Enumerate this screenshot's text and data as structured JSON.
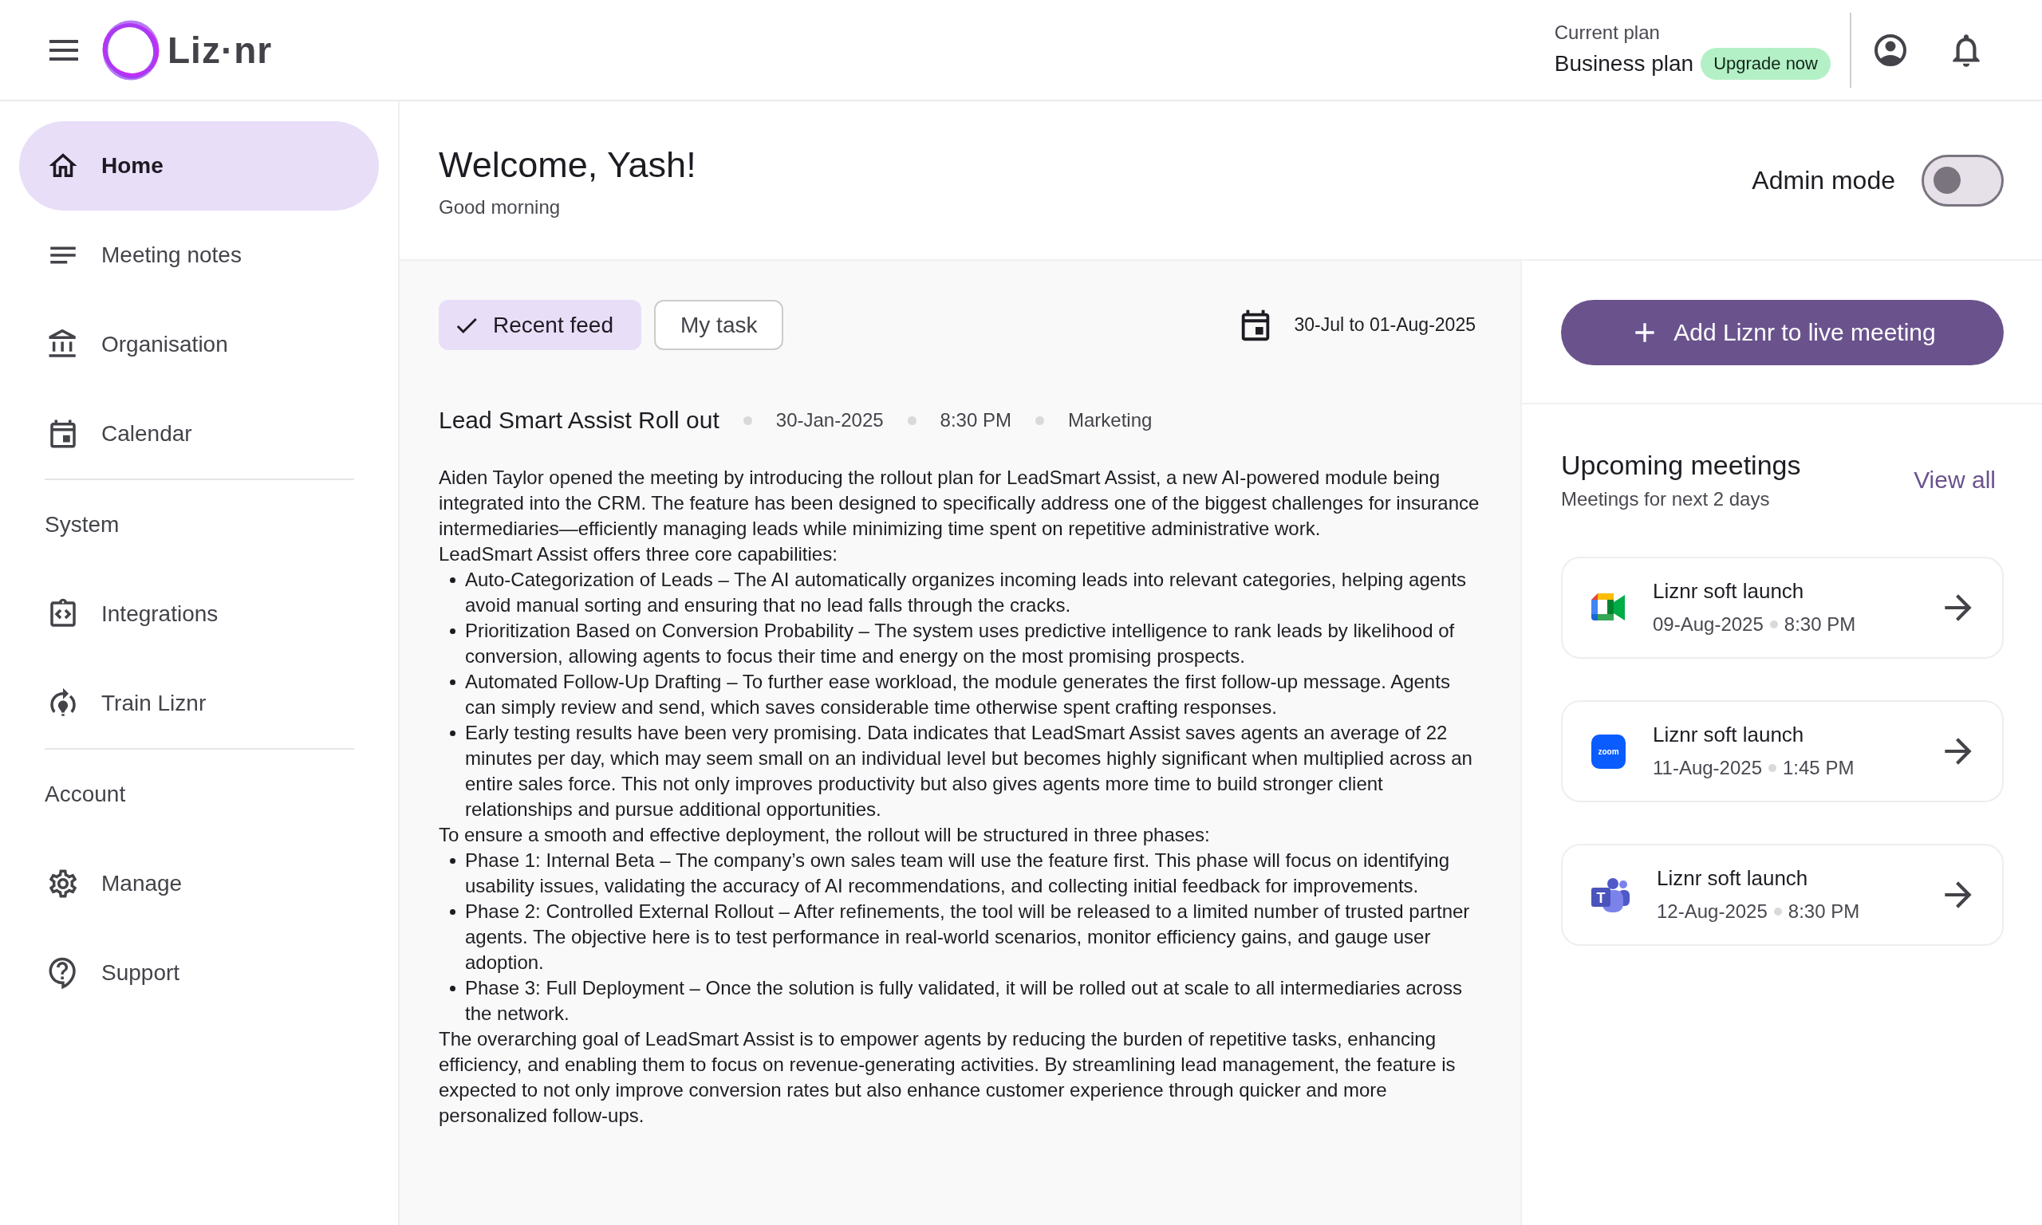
{
  "header": {
    "logo_text": "Liz·nr",
    "plan": {
      "caption": "Current plan",
      "name": "Business plan",
      "badge": "Upgrade now"
    }
  },
  "sidebar": {
    "sections": [
      {
        "items": [
          {
            "label": "Home",
            "selected": true
          },
          {
            "label": "Meeting notes",
            "selected": false
          },
          {
            "label": "Organisation",
            "selected": false
          },
          {
            "label": "Calendar",
            "selected": false
          }
        ]
      },
      {
        "heading": "System",
        "items": [
          {
            "label": "Integrations",
            "selected": false
          },
          {
            "label": "Train Liznr",
            "selected": false
          }
        ]
      },
      {
        "heading": "Account",
        "items": [
          {
            "label": "Manage",
            "selected": false
          },
          {
            "label": "Support",
            "selected": false
          }
        ]
      }
    ]
  },
  "welcome": {
    "title": "Welcome, Yash!",
    "subtitle": "Good morning"
  },
  "admin_mode": {
    "label": "Admin mode",
    "on": false
  },
  "tabs": [
    {
      "label": "Recent feed",
      "selected": true
    },
    {
      "label": "My task",
      "selected": false
    }
  ],
  "date_range": "30-Jul to 01-Aug-2025",
  "post": {
    "title": "Lead Smart Assist Roll out",
    "meta": [
      "30-Jan-2025",
      "8:30 PM",
      "Marketing"
    ],
    "body": [
      {
        "kind": "paragraph",
        "text": "Aiden Taylor opened the meeting by introducing the rollout plan for LeadSmart Assist, a new AI-powered module being integrated into the CRM. The feature has been designed to specifically address one of the biggest challenges for insurance intermediaries—efficiently managing leads while minimizing time spent on repetitive administrative work."
      },
      {
        "kind": "paragraph",
        "text": "LeadSmart Assist offers three core capabilities:"
      },
      {
        "kind": "bullets",
        "items": [
          "Auto-Categorization of Leads – The AI automatically organizes incoming leads into relevant categories, helping agents avoid manual sorting and ensuring that no lead falls through the cracks.",
          "Prioritization Based on Conversion Probability – The system uses predictive intelligence to rank leads by likelihood of conversion, allowing agents to focus their time and energy on the most promising prospects.",
          "Automated Follow-Up Drafting – To further ease workload, the module generates the first follow-up message. Agents can simply review and send, which saves considerable time otherwise spent crafting responses.",
          "Early testing results have been very promising. Data indicates that LeadSmart Assist saves agents an average of 22 minutes per day, which may seem small on an individual level but becomes highly significant when multiplied across an entire sales force. This not only improves productivity but also gives agents more time to build stronger client relationships and pursue additional opportunities."
        ]
      },
      {
        "kind": "paragraph",
        "text": "To ensure a smooth and effective deployment, the rollout will be structured in three phases:"
      },
      {
        "kind": "bullets",
        "items": [
          "Phase 1: Internal Beta – The company’s own sales team will use the feature first. This phase will focus on identifying usability issues, validating the accuracy of AI recommendations, and collecting initial feedback for improvements.",
          "Phase 2: Controlled External Rollout – After refinements, the tool will be released to a limited number of trusted partner agents. The objective here is to test performance in real-world scenarios, monitor efficiency gains, and gauge user adoption.",
          "Phase 3: Full Deployment – Once the solution is fully validated, it will be rolled out at scale to all intermediaries across the network."
        ]
      },
      {
        "kind": "paragraph",
        "text": "The overarching goal of LeadSmart Assist is to empower agents by reducing the burden of repetitive tasks, enhancing efficiency, and enabling them to focus on revenue-generating activities. By streamlining lead management, the feature is expected to not only improve conversion rates but also enhance customer experience through quicker and more personalized follow-ups."
      }
    ]
  },
  "live_button": "Add Liznr to live meeting",
  "upcoming": {
    "title": "Upcoming meetings",
    "subtitle": "Meetings for next 2 days",
    "link": "View all",
    "meetings": [
      {
        "kind": "meet",
        "title": "Liznr soft launch",
        "date": "09-Aug-2025",
        "time": "8:30 PM"
      },
      {
        "kind": "zoom",
        "logo_text": "zoom",
        "title": "Liznr soft launch",
        "date": "11-Aug-2025",
        "time": "1:45 PM"
      },
      {
        "kind": "teams",
        "logo_text": "T",
        "title": "Liznr soft launch",
        "date": "12-Aug-2025",
        "time": "8:30 PM"
      }
    ]
  }
}
